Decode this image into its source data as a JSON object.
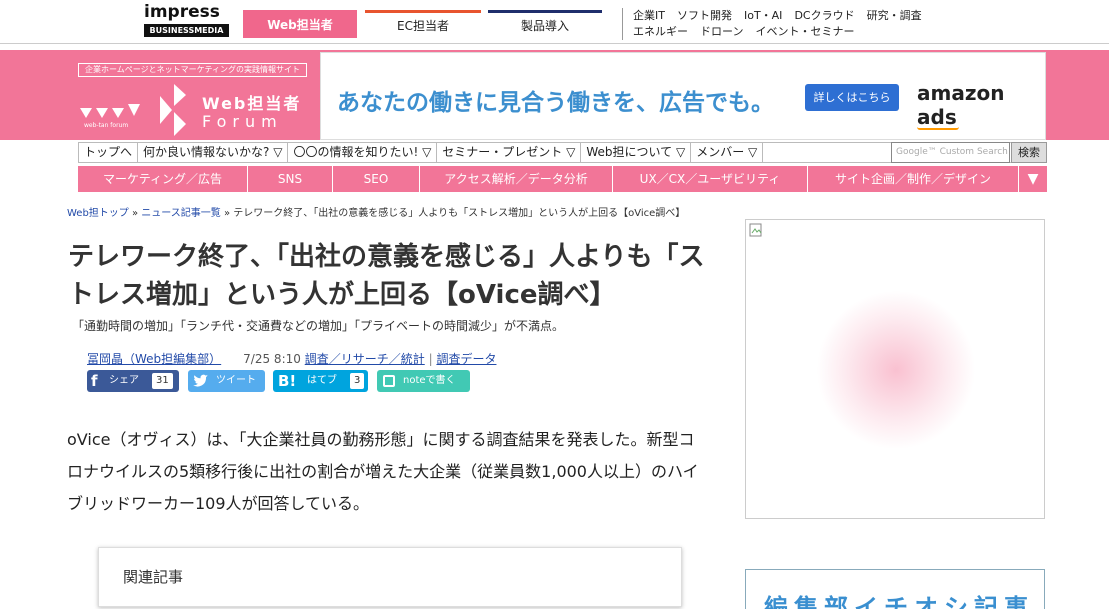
{
  "topbar": {
    "logo_word": "impress",
    "logo_sub": "BUSINESSMEDIA",
    "tabs": [
      {
        "label": "Web担当者"
      },
      {
        "label": "EC担当者"
      },
      {
        "label": "製品導入"
      }
    ],
    "links_row1": [
      "企業IT",
      "ソフト開発",
      "IoT・AI",
      "DCクラウド",
      "研究・調査"
    ],
    "links_row2": [
      "エネルギー",
      "ドローン",
      "イベント・セミナー"
    ]
  },
  "header": {
    "tagline": "企業ホームページとネットマーケティングの実践情報サイト",
    "logo_line1": "Web担当者",
    "logo_line2": "Forum",
    "logo_small": "web-tan forum"
  },
  "ad": {
    "headline": "あなたの働きに見合う働きを、広告でも。",
    "button": "詳しくはこちら",
    "brand": "amazon ads"
  },
  "menu_primary": [
    "トップへ",
    "何か良い情報ないかな? ▽",
    "〇〇の情報を知りたい! ▽",
    "セミナー・プレゼント ▽",
    "Web担について ▽",
    "メンバー ▽"
  ],
  "search": {
    "placeholder": "Google™ Custom Search",
    "button": "検索"
  },
  "menu_secondary": [
    "マーケティング／広告",
    "SNS",
    "SEO",
    "アクセス解析／データ分析",
    "UX／CX／ユーザビリティ",
    "サイト企画／制作／デザイン"
  ],
  "menu_more": "▼",
  "breadcrumb": {
    "home": "Web担トップ",
    "sep1": " » ",
    "list": "ニュース記事一覧",
    "sep2": " » ",
    "current": "テレワーク終了、「出社の意義を感じる」人よりも「ストレス増加」という人が上回る【oVice調べ】"
  },
  "article": {
    "title": "テレワーク終了、「出社の意義を感じる」人よりも「ストレス増加」という人が上回る【oVice調べ】",
    "subtitle": "「通勤時間の増加」「ランチ代・交通費などの増加」「プライベートの時間減少」が不満点。",
    "author": "冨岡晶（Web担編集部）",
    "date": "7/25 8:10",
    "category1": "調査／リサーチ／統計",
    "separator": "|",
    "category2": "調査データ",
    "body": "oVice（オヴィス）は、「大企業社員の勤務形態」に関する調査結果を発表した。新型コロナウイルスの5類移行後に出社の割合が増えた大企業（従業員数1,000人以上）のハイブリッドワーカー109人が回答している。"
  },
  "share": {
    "facebook_label": "シェア",
    "facebook_count": "31",
    "twitter_label": "ツイート",
    "hatena_mark": "B!",
    "hatena_label": "はてブ",
    "hatena_count": "3",
    "note_label": "noteで書く"
  },
  "related": {
    "heading": "関連記事"
  },
  "sidebox2": {
    "text": "編集部イチオシ記事"
  },
  "colors": {
    "brand_pink": "#f27598",
    "link": "#224aa8",
    "facebook": "#3b5998",
    "twitter": "#55acee",
    "hatena": "#00a4de",
    "note": "#41c9b4"
  }
}
